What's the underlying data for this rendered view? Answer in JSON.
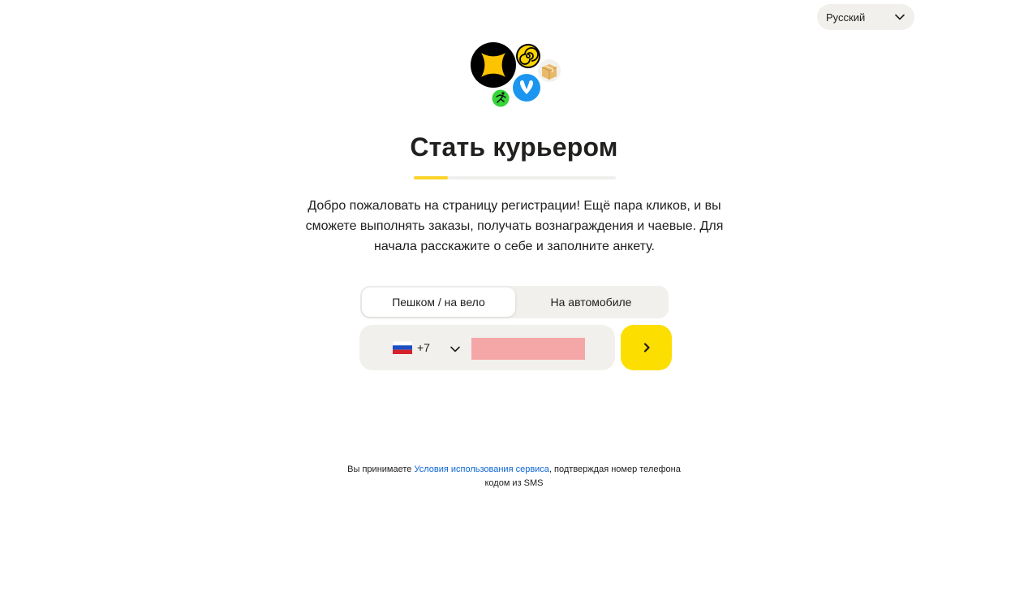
{
  "language_selector": {
    "value": "Русский"
  },
  "title": "Стать курьером",
  "progress": {
    "fraction": 0.17,
    "color": "#fcd32a"
  },
  "intro": "Добро пожаловать на страницу регистрации! Ещё пара кликов, и вы сможете выполнять заказы, получать вознаграждения и чаевые. Для начала расскажите о себе и заполните анкету.",
  "tabs": [
    {
      "label": "Пешком / на вело",
      "selected": true
    },
    {
      "label": "На автомобиле",
      "selected": false
    }
  ],
  "phone": {
    "country": "Russia",
    "country_code": "+7",
    "value": ""
  },
  "next_button": {
    "icon": "chevron-right-icon",
    "color": "#fcde00"
  },
  "terms": {
    "prefix": "Вы принимаете ",
    "link": "Условия использования сервиса",
    "line1_suffix": ", подтверждая номер телефона",
    "line2": "кодом из SMS"
  }
}
